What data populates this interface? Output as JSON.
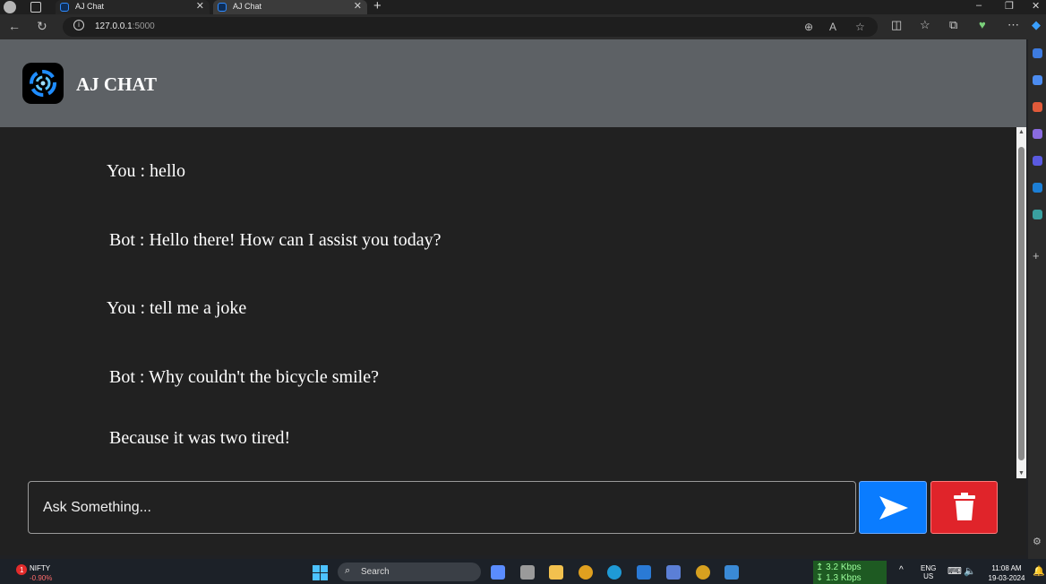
{
  "browser": {
    "tabs": [
      {
        "title": "AJ Chat",
        "active": false
      },
      {
        "title": "AJ Chat",
        "active": true
      }
    ],
    "address": {
      "host": "127.0.0.1",
      "port": ":5000"
    }
  },
  "app": {
    "title": "AJ CHAT",
    "messages": [
      {
        "text": "You : hello"
      },
      {
        "text": "Bot : Hello there! How can I assist you today?"
      },
      {
        "text": "You : tell me a joke"
      },
      {
        "text": "Bot : Why couldn't the bicycle smile?"
      },
      {
        "text": "Because it was two tired!"
      }
    ],
    "input_placeholder": "Ask Something...",
    "send_icon": "send-arrow-icon",
    "delete_icon": "trash-icon",
    "colors": {
      "send": "#0a7cff",
      "delete": "#e0242a",
      "header": "#5d6165",
      "background": "#212121"
    }
  },
  "taskbar": {
    "stock": {
      "name": "NIFTY",
      "change": "-0.90%"
    },
    "search_label": "Search",
    "network": {
      "up": "3.2 Kbps",
      "down": "1.3 Kbps"
    },
    "language": {
      "lang": "ENG",
      "region": "US"
    },
    "clock": {
      "time": "11:08 AM",
      "date": "19-03-2024"
    }
  }
}
